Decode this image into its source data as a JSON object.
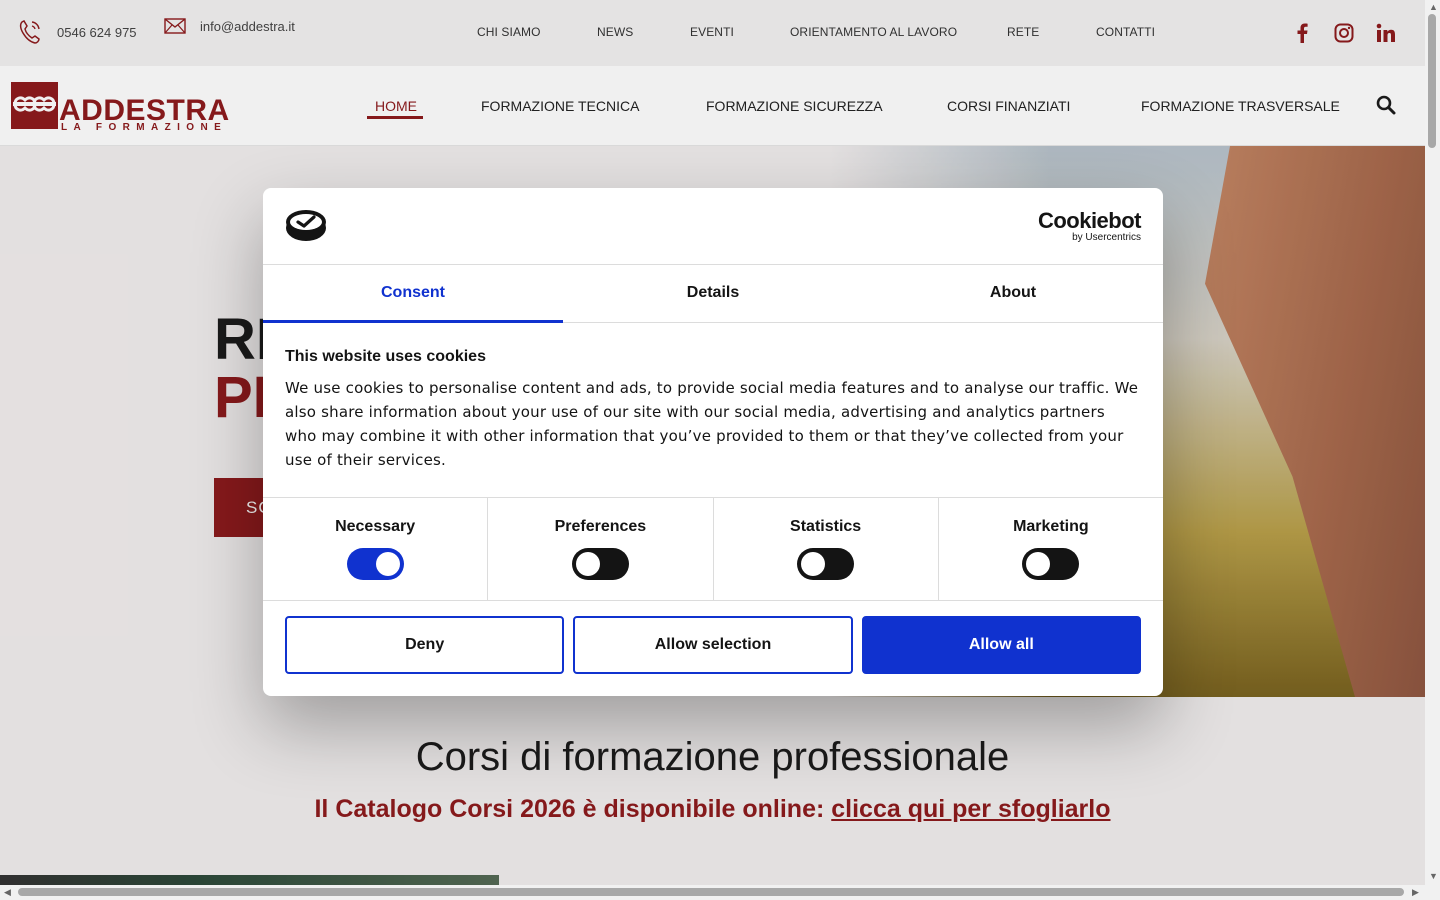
{
  "topbar": {
    "phone": "0546 624 975",
    "email": "info@addestra.it",
    "links": [
      "CHI SIAMO",
      "NEWS",
      "EVENTI",
      "ORIENTAMENTO AL LAVORO",
      "RETE",
      "CONTATTI"
    ],
    "social": [
      "facebook-icon",
      "instagram-icon",
      "linkedin-icon"
    ]
  },
  "logo": {
    "name": "ADDESTRA",
    "tagline": "LA FORMAZIONE"
  },
  "nav": {
    "items": [
      "HOME",
      "FORMAZIONE TECNICA",
      "FORMAZIONE SICUREZZA",
      "CORSI FINANZIATI",
      "FORMAZIONE TRASVERSALE"
    ],
    "active": "HOME"
  },
  "hero": {
    "title_line1": "RI",
    "title_line2": "PI",
    "cta": "SC"
  },
  "section": {
    "title": "Corsi di formazione professionale",
    "catalog_text": "Il Catalogo Corsi 2026 è disponibile online: ",
    "catalog_link": "clicca qui per sfogliarlo"
  },
  "cookie": {
    "brand": "Cookiebot",
    "brand_sub": "by Usercentrics",
    "tabs": [
      "Consent",
      "Details",
      "About"
    ],
    "active_tab": "Consent",
    "heading": "This website uses cookies",
    "body": "We use cookies to personalise content and ads, to provide social media features and to analyse our traffic. We also share information about your use of our site with our social media, advertising and analytics partners who may combine it with other information that you’ve provided to them or that they’ve collected from your use of their services.",
    "toggles": [
      {
        "label": "Necessary",
        "on": true
      },
      {
        "label": "Preferences",
        "on": false
      },
      {
        "label": "Statistics",
        "on": false
      },
      {
        "label": "Marketing",
        "on": false
      }
    ],
    "buttons": {
      "deny": "Deny",
      "allow_selection": "Allow selection",
      "allow_all": "Allow all"
    }
  },
  "colors": {
    "brand_red": "#8e1b1d",
    "cookie_blue": "#1032cf"
  }
}
